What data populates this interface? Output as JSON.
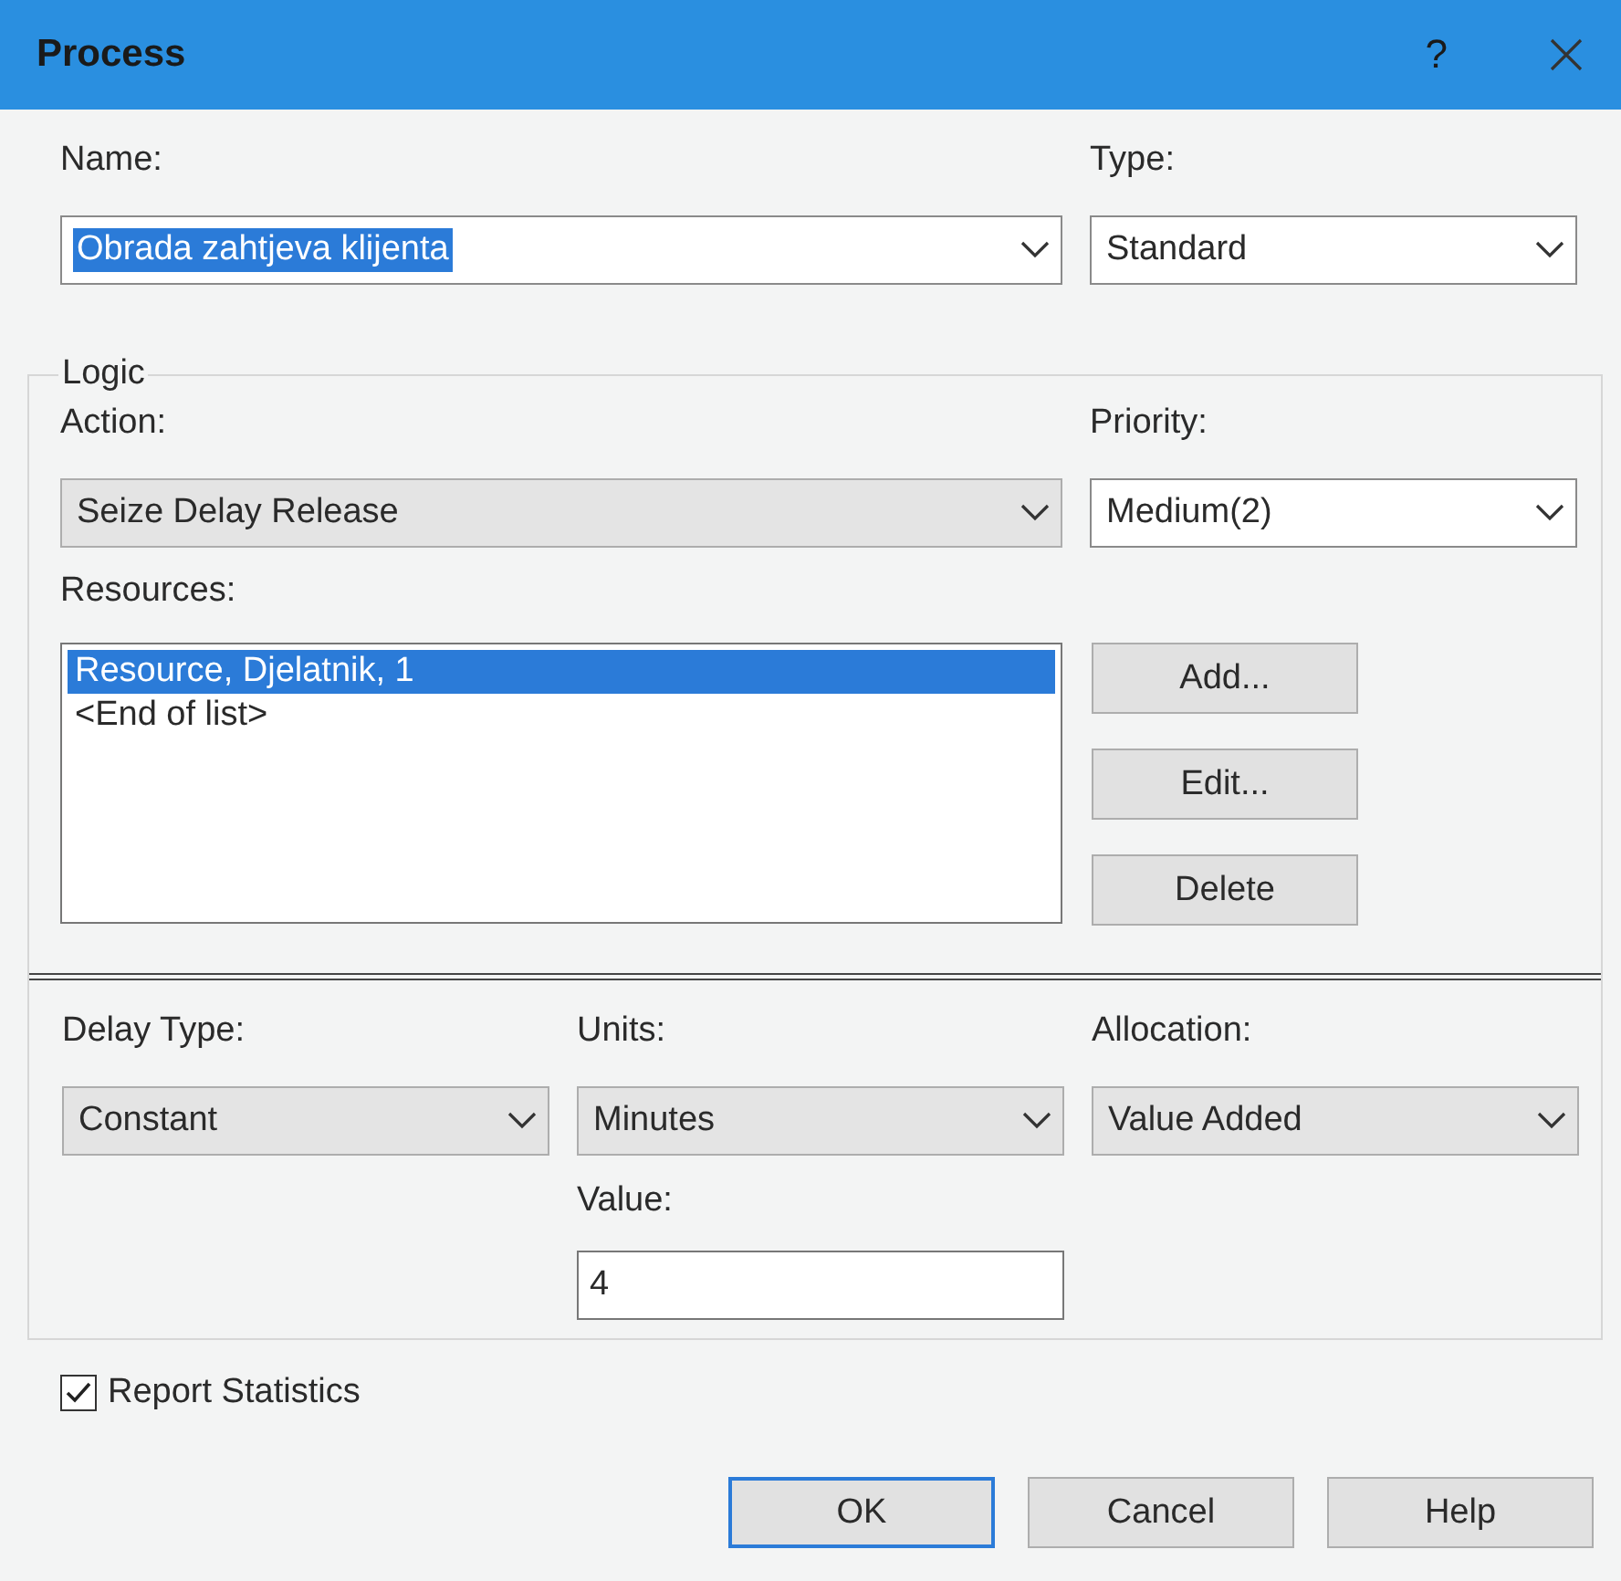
{
  "window": {
    "title": "Process",
    "help": "?"
  },
  "name": {
    "label": "Name:",
    "value": "Obrada zahtjeva klijenta",
    "kind": "editable",
    "text_selected": true
  },
  "type": {
    "label": "Type:",
    "value": "Standard",
    "kind": "editable"
  },
  "logic": {
    "title": "Logic",
    "action": {
      "label": "Action:",
      "value": "Seize Delay Release",
      "kind": "dropdown"
    },
    "priority": {
      "label": "Priority:",
      "value": "Medium(2)",
      "kind": "editable"
    },
    "resources": {
      "label": "Resources:",
      "items": [
        {
          "text": "Resource, Djelatnik, 1",
          "selected": true
        },
        {
          "text": "<End of list>",
          "selected": false
        }
      ],
      "buttons": [
        "Add...",
        "Edit...",
        "Delete"
      ]
    },
    "delay_type": {
      "label": "Delay Type:",
      "value": "Constant",
      "kind": "dropdown"
    },
    "units": {
      "label": "Units:",
      "value": "Minutes",
      "kind": "dropdown"
    },
    "allocation": {
      "label": "Allocation:",
      "value": "Value Added",
      "kind": "dropdown"
    },
    "value": {
      "label": "Value:",
      "value": "4"
    }
  },
  "report_statistics": {
    "label": "Report Statistics",
    "checked": true
  },
  "buttons": [
    {
      "label": "OK",
      "default": true
    },
    {
      "label": "Cancel",
      "default": false
    },
    {
      "label": "Help",
      "default": false
    }
  ]
}
